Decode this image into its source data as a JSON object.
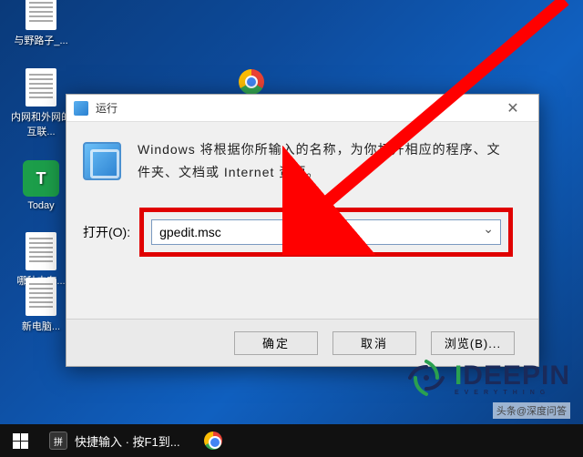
{
  "desktop": {
    "icons": [
      {
        "label": "与野路子_..."
      },
      {
        "label": "内网和外网的互联..."
      },
      {
        "label": "Today"
      },
      {
        "label": "哪种内存..."
      },
      {
        "label": "新电脑..."
      }
    ]
  },
  "run_dialog": {
    "title": "运行",
    "description": "Windows 将根据你所输入的名称，为你打开相应的程序、文件夹、文档或 Internet 资源。",
    "open_label": "打开(O):",
    "input_value": "gpedit.msc",
    "ok_label": "确定",
    "cancel_label": "取消",
    "browse_label": "浏览(B)..."
  },
  "taskbar": {
    "quick_input": "快捷输入 · 按F1到..."
  },
  "watermark": {
    "brand_html_prefix": "I",
    "brand_html_rest": "DEEPIN",
    "credit": "头条@深度问答"
  },
  "colors": {
    "highlight_box": "#e00000",
    "arrow": "#ff0000"
  }
}
